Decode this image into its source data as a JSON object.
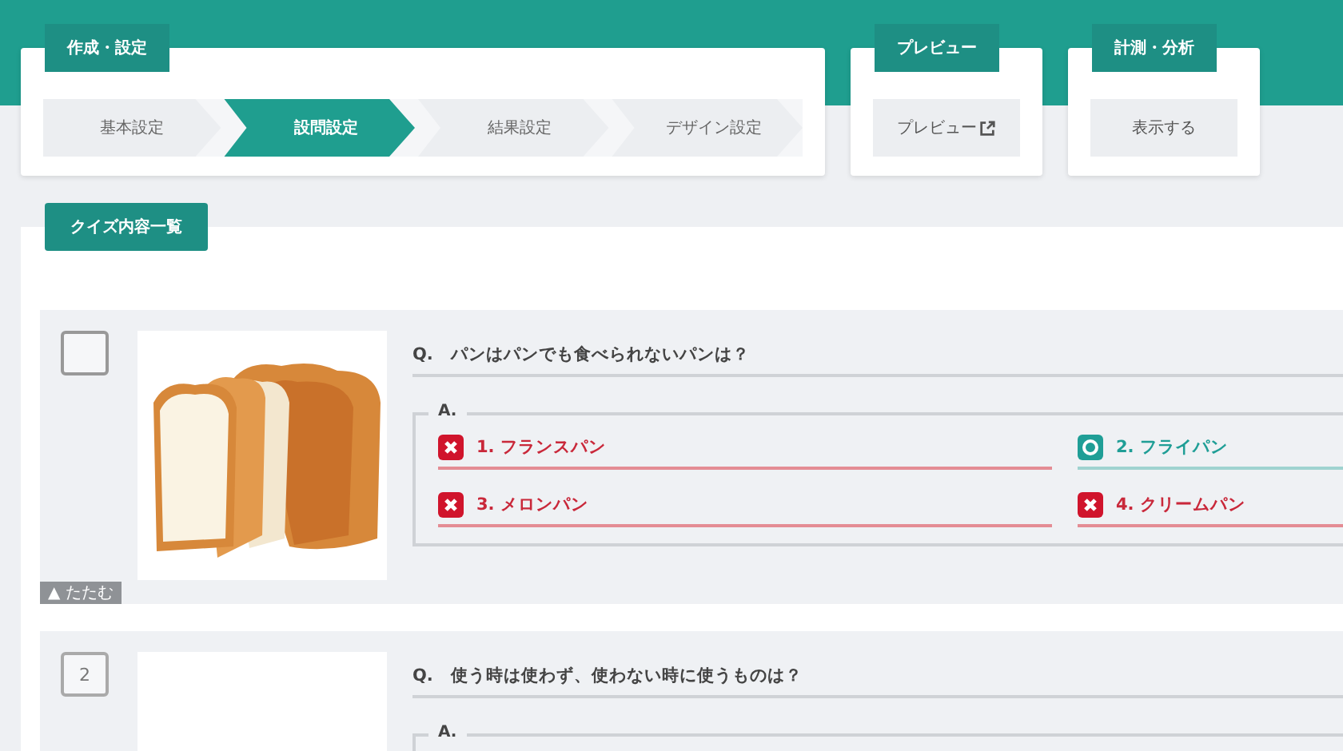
{
  "panels": [
    {
      "label": "作成・設定",
      "kind": "steps",
      "steps": [
        {
          "label": "基本設定",
          "selected": false
        },
        {
          "label": "設問設定",
          "selected": true
        },
        {
          "label": "結果設定",
          "selected": false
        },
        {
          "label": "デザイン設定",
          "selected": false
        }
      ]
    },
    {
      "label": "プレビュー",
      "kind": "button",
      "button": "プレビュー",
      "external": true
    },
    {
      "label": "計測・分析",
      "kind": "button",
      "button": "表示する",
      "external": false
    }
  ],
  "quiz_list": {
    "title": "クイズ内容一覧",
    "items": [
      {
        "marker": {
          "kind": "checkbox",
          "checked": false
        },
        "question": "Q.　パンはパンでも食べられないパンは？",
        "answer_label": "A.",
        "choices": [
          {
            "label": "1. フランスパン",
            "correct": false
          },
          {
            "label": "2. フライパン",
            "correct": true
          },
          {
            "label": "3. メロンパン",
            "correct": false
          },
          {
            "label": "4. クリームパン",
            "correct": false
          }
        ],
        "collapse": "▲ たたむ"
      },
      {
        "marker": {
          "kind": "number",
          "text": "2"
        },
        "image": {
          "kind": "blank"
        },
        "question": "Q.　使う時は使わず、使わない時に使うものは？",
        "answer_label": "A."
      }
    ]
  }
}
